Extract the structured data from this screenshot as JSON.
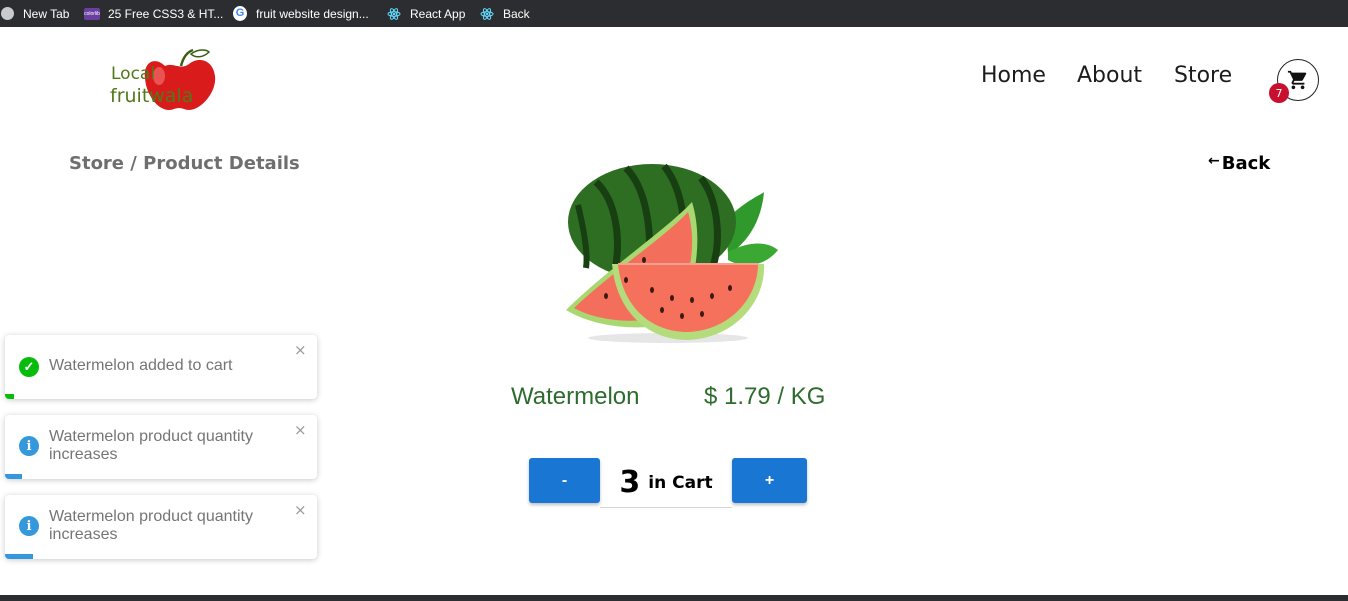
{
  "bookmarks": [
    {
      "label": "New Tab",
      "icon": "globe-icon"
    },
    {
      "label": "25 Free CSS3 & HT...",
      "icon": "colorlib-icon"
    },
    {
      "label": "fruit website design...",
      "icon": "google-icon"
    },
    {
      "label": "React App",
      "icon": "react-icon"
    },
    {
      "label": "Back",
      "icon": "react-icon"
    }
  ],
  "logo": {
    "line1": "Local",
    "line2": "fruitwala"
  },
  "nav": {
    "home": "Home",
    "about": "About",
    "store": "Store"
  },
  "cart": {
    "count": "7",
    "icon": "shopping-cart-icon"
  },
  "breadcrumb": "Store / Product Details",
  "back": {
    "label": "Back",
    "icon": "arrow-left-icon"
  },
  "product": {
    "name": "Watermelon",
    "price": "$ 1.79 / KG",
    "quantity": "3",
    "quantity_label": "in Cart",
    "minus_label": "-",
    "plus_label": "+"
  },
  "toasts": [
    {
      "type": "success",
      "message": "Watermelon added to cart",
      "close": "×",
      "progress": 0.03
    },
    {
      "type": "info",
      "message": "Watermelon product quantity increases",
      "close": "×",
      "progress": 0.055
    },
    {
      "type": "info",
      "message": "Watermelon product quantity increases",
      "close": "×",
      "progress": 0.09
    }
  ],
  "colors": {
    "primary_button": "#1976d2",
    "product_text": "#2e6b2e",
    "badge": "#c8102e",
    "toast_success": "#07bc0c",
    "toast_info": "#3498db"
  }
}
